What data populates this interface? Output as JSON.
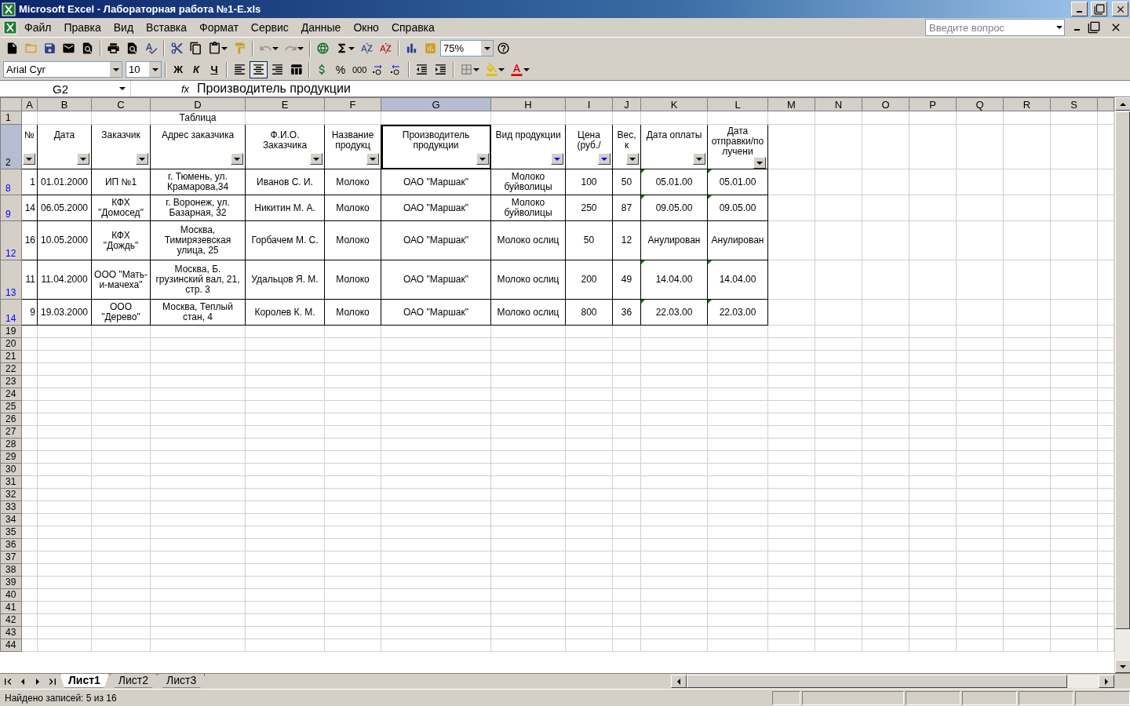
{
  "window": {
    "title": "Microsoft Excel - Лабораторная работа №1-E.xls"
  },
  "menu": [
    "Файл",
    "Правка",
    "Вид",
    "Вставка",
    "Формат",
    "Сервис",
    "Данные",
    "Окно",
    "Справка"
  ],
  "help_search": {
    "placeholder": "Введите вопрос"
  },
  "standard_toolbar": {
    "zoom": "75%"
  },
  "formatting_toolbar": {
    "font": "Arial Cyr",
    "size": "10",
    "style_buttons": [
      "Ж",
      "К",
      "Ч"
    ],
    "alignment": [
      {
        "selected": false
      },
      {
        "selected": true
      },
      {
        "selected": false
      }
    ],
    "number_buttons": [
      "%",
      "000"
    ]
  },
  "formula_bar": {
    "name_box": "G2",
    "fx_label": "fx",
    "formula": "Производитель продукции"
  },
  "columns": [
    {
      "letter": "A",
      "selected": false
    },
    {
      "letter": "B",
      "selected": false
    },
    {
      "letter": "C",
      "selected": false
    },
    {
      "letter": "D",
      "selected": false
    },
    {
      "letter": "E",
      "selected": false
    },
    {
      "letter": "F",
      "selected": false
    },
    {
      "letter": "G",
      "selected": true
    },
    {
      "letter": "H",
      "selected": false
    },
    {
      "letter": "I",
      "selected": false
    },
    {
      "letter": "J",
      "selected": false
    },
    {
      "letter": "K",
      "selected": false
    },
    {
      "letter": "L",
      "selected": false
    },
    {
      "letter": "M",
      "selected": false
    },
    {
      "letter": "N",
      "selected": false
    },
    {
      "letter": "O",
      "selected": false
    },
    {
      "letter": "P",
      "selected": false
    },
    {
      "letter": "Q",
      "selected": false
    },
    {
      "letter": "R",
      "selected": false
    },
    {
      "letter": "S",
      "selected": false
    }
  ],
  "title_row": {
    "number": "1",
    "text": "Таблица"
  },
  "header_row": {
    "number": "2",
    "selected": true,
    "headers": [
      {
        "text": "№",
        "filter_active": false
      },
      {
        "text": "Дата",
        "filter_active": false
      },
      {
        "text": "Заказчик",
        "filter_active": false
      },
      {
        "text": "Адрес заказчика",
        "filter_active": false
      },
      {
        "text": "Ф.И.О. Заказчика",
        "filter_active": false
      },
      {
        "text": "Название продукц",
        "filter_active": false
      },
      {
        "text": "Производитель продукции",
        "filter_active": false
      },
      {
        "text": "Вид продукции",
        "filter_active": true
      },
      {
        "text": "Цена (руб./",
        "filter_active": true
      },
      {
        "text": "Вес, к",
        "filter_active": false
      },
      {
        "text": "Дата оплаты",
        "filter_active": false
      },
      {
        "text": "Дата отправки/по лучени",
        "filter_active": false
      }
    ]
  },
  "rows": [
    {
      "number": "8",
      "date_marks": true,
      "cells": [
        "1",
        "01.01.2000",
        "ИП №1",
        "г. Тюмень, ул. Крамарова,34",
        "Иванов С. И.",
        "Молоко",
        "ОАО \"Маршак\"",
        "Молоко буйволицы",
        "100",
        "50",
        "05.01.00",
        "05.01.00"
      ]
    },
    {
      "number": "9",
      "date_marks": true,
      "cells": [
        "14",
        "06.05.2000",
        "КФХ \"Домосед\"",
        "г. Воронеж, ул. Базарная, 32",
        "Никитин М. А.",
        "Молоко",
        "ОАО \"Маршак\"",
        "Молоко буйволицы",
        "250",
        "87",
        "09.05.00",
        "09.05.00"
      ]
    },
    {
      "number": "12",
      "date_marks": false,
      "cells": [
        "16",
        "10.05.2000",
        "КФХ \"Дождь\"",
        "Москва, Тимирязевская улица, 25",
        "Горбачем М. С.",
        "Молоко",
        "ОАО \"Маршак\"",
        "Молоко ослиц",
        "50",
        "12",
        "Анулирован",
        "Анулирован"
      ]
    },
    {
      "number": "13",
      "date_marks": true,
      "cells": [
        "11",
        "11.04.2000",
        "ООО \"Мать-и-мачеха\"",
        "Москва, Б. грузинский вал, 21, стр. 3",
        "Удальцов Я. М.",
        "Молоко",
        "ОАО \"Маршак\"",
        "Молоко ослиц",
        "200",
        "49",
        "14.04.00",
        "14.04.00"
      ]
    },
    {
      "number": "14",
      "date_marks": true,
      "cells": [
        "9",
        "19.03.2000",
        "ООО \"Дерево\"",
        "Москва, Теплый стан, 4",
        "Королев К. М.",
        "Молоко",
        "ОАО \"Маршак\"",
        "Молоко ослиц",
        "800",
        "36",
        "22.03.00",
        "22.03.00"
      ]
    }
  ],
  "blank_rows": [
    "19",
    "20",
    "21",
    "22",
    "23",
    "24",
    "25",
    "26",
    "27",
    "28",
    "29",
    "30",
    "31",
    "32",
    "33",
    "34",
    "35",
    "36",
    "37",
    "38",
    "39",
    "40",
    "41",
    "42",
    "43",
    "44"
  ],
  "sheets": [
    {
      "name": "Лист1",
      "selected": true
    },
    {
      "name": "Лист2",
      "selected": false
    },
    {
      "name": "Лист3",
      "selected": false
    }
  ],
  "status_bar": "Найдено записей: 5 из 16"
}
